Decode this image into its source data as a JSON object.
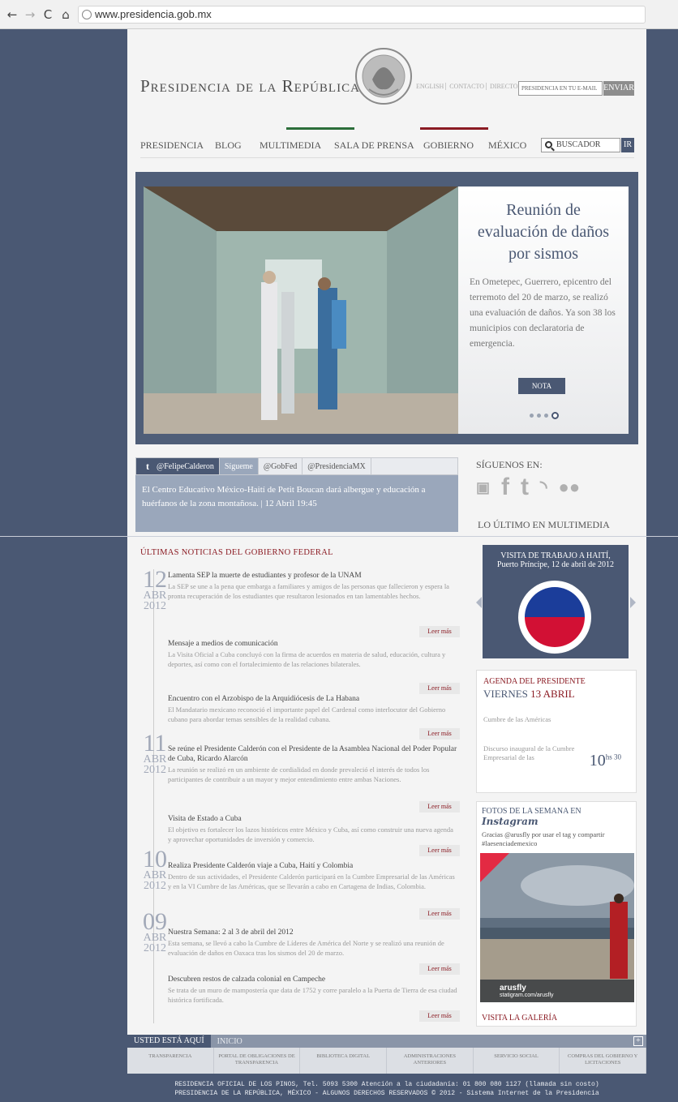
{
  "browser": {
    "url": "www.presidencia.gob.mx"
  },
  "header": {
    "title": "Presidencia de la República",
    "utility_links": [
      "ENGLISH",
      "CONTACTO",
      "DIRECTORIO"
    ],
    "email_placeholder": "PRESIDENCIA EN TU E-MAIL",
    "send_label": "ENVIAR",
    "nav": [
      "PRESIDENCIA",
      "BLOG",
      "MULTIMEDIA",
      "SALA DE PRENSA",
      "GOBIERNO",
      "MÉXICO"
    ],
    "search_placeholder": "BUSCADOR",
    "search_button": "IR"
  },
  "slider": {
    "title": "Reunión de evaluación de daños por sismos",
    "text": "En Ometepec, Guerrero, epicentro del terremoto del 20 de marzo, se realizó una evaluación de daños. Ya son 38 los municipios con declaratoria de emergencia.",
    "button": "NOTA"
  },
  "twitter": {
    "tabs": [
      "@FelipeCalderon",
      "Sígueme",
      "@GobFed",
      "@PresidenciaMX"
    ],
    "text": "El Centro Educativo México-Haití de Petit Boucan dará albergue y educación a huérfanos de la zona montañosa. | 12 Abril 19:45"
  },
  "right": {
    "follow_label": "SÍGUENOS EN:",
    "multimedia_label": "LO ÚLTIMO EN MULTIMEDIA",
    "multimedia_caption_1": "VISITA DE TRABAJO A HAITÍ,",
    "multimedia_caption_2": "Puerto Príncipe, 12 de abril de 2012",
    "agenda_title": "AGENDA DEL PRESIDENTE",
    "agenda_day": "VIERNES",
    "agenda_date": "13 ABRIL",
    "agenda_item1": "Cumbre de las Américas",
    "agenda_item2": "Discurso inaugural de la Cumbre Empresarial de las",
    "agenda_time": "10",
    "agenda_time_suffix": "hs 30",
    "insta_title": "FOTOS DE LA SEMANA EN",
    "insta_brand": "Instagram",
    "insta_text": "Gracias @arusfly por usar el tag y compartir #laesenciademexico",
    "insta_user": "arusfly",
    "insta_link": "statigram.com/arusfly",
    "gallery_link": "VISITA LA GALERÍA"
  },
  "news": {
    "heading": "ÚLTIMAS NOTICIAS DEL GOBIERNO FEDERAL",
    "more_label": "Leer más",
    "dates": [
      {
        "d": "12",
        "m": "ABR",
        "y": "2012"
      },
      {
        "d": "11",
        "m": "ABR",
        "y": "2012"
      },
      {
        "d": "10",
        "m": "ABR",
        "y": "2012"
      },
      {
        "d": "09",
        "m": "ABR",
        "y": "2012"
      }
    ],
    "articles": [
      {
        "h": "Lamenta SEP la muerte de estudiantes y profesor de la UNAM",
        "b": "La SEP se une a la pena que embarga a familiares y amigos de las personas que fallecieron y espera la pronta recuperación de los estudiantes que resultaron lesionados en tan lamentables hechos."
      },
      {
        "h": "Mensaje a medios de comunicación",
        "b": "La Visita Oficial a Cuba concluyó con la firma de acuerdos en materia de salud, educación, cultura y deportes, así como con el fortalecimiento de las relaciones bilaterales."
      },
      {
        "h": "Encuentro con el Arzobispo de la Arquidiócesis de La Habana",
        "b": "El Mandatario mexicano reconoció el importante papel del Cardenal como interlocutor del Gobierno cubano para abordar temas sensibles de la realidad cubana."
      },
      {
        "h": "Se reúne el Presidente Calderón con el Presidente de la Asamblea Nacional del Poder Popular de Cuba, Ricardo Alarcón",
        "b": "La reunión se realizó en un ambiente de cordialidad en donde prevaleció el interés de todos los participantes de contribuir a un mayor y mejor entendimiento entre ambas Naciones."
      },
      {
        "h": "Visita de Estado a Cuba",
        "b": "El objetivo es fortalecer los lazos históricos entre México y Cuba, así como construir una nueva agenda y aprovechar oportunidades de inversión y comercio."
      },
      {
        "h": "Realiza Presidente Calderón viaje a Cuba, Haití y Colombia",
        "b": "Dentro de sus actividades, el Presidente Calderón participará en la Cumbre Empresarial de las Américas y en la VI Cumbre de las Américas, que se llevarán a cabo en Cartagena de Indias, Colombia."
      },
      {
        "h": "Nuestra Semana: 2 al 3 de abril del 2012",
        "b": "Esta semana, se llevó a cabo la Cumbre de Líderes de América del Norte y se realizó una reunión de evaluación de daños en Oaxaca tras los sismos del 20 de marzo."
      },
      {
        "h": "Descubren restos de calzada colonial en Campeche",
        "b": "Se trata de un muro de mampostería que data de 1752 y corre paralelo a la Puerta de Tierra de esa ciudad histórica fortificada."
      }
    ]
  },
  "footer": {
    "breadcrumb_here": "USTED ESTÁ AQUÍ",
    "breadcrumb_home": "INICIO",
    "links": [
      "TRANSPARENCIA",
      "PORTAL DE OBLIGACIONES DE TRANSPARENCIA",
      "BIBLIOTECA DIGITAL",
      "ADMINISTRACIONES ANTERIORES",
      "SERVICIO SOCIAL",
      "COMPRAS DEL GOBIERNO Y LICITACIONES"
    ],
    "line1": "RESIDENCIA OFICIAL DE LOS PINOS, Tel. 5093 5300 Atención a la ciudadanía: 01 800 080 1127 (llamada sin costo)",
    "line2": "PRESIDENCIA DE LA REPÚBLICA, MÉXICO - ALGUNOS DERECHOS RESERVADOS © 2012 - Sistema Internet de la Presidencia"
  }
}
